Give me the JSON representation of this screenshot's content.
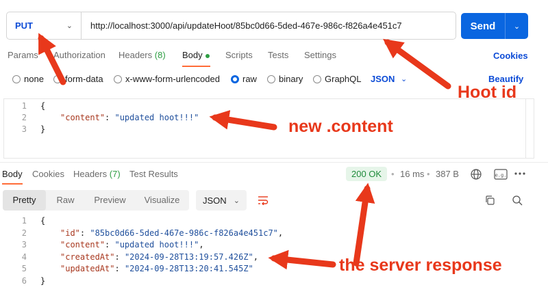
{
  "request": {
    "method": "PUT",
    "url": "http://localhost:3000/api/updateHoot/85bc0d66-5ded-467e-986c-f826a4e451c7",
    "send_label": "Send"
  },
  "req_tabs": [
    {
      "label": "Params"
    },
    {
      "label": "Authorization"
    },
    {
      "label": "Headers",
      "count": "(8)"
    },
    {
      "label": "Body"
    },
    {
      "label": "Scripts"
    },
    {
      "label": "Tests"
    },
    {
      "label": "Settings"
    }
  ],
  "cookies_label": "Cookies",
  "body_types": [
    "none",
    "form-data",
    "x-www-form-urlencoded",
    "raw",
    "binary",
    "GraphQL"
  ],
  "selected_body_type": "raw",
  "language": "JSON",
  "beautify_label": "Beautify",
  "request_body": {
    "line_numbers": [
      "1",
      "2",
      "3"
    ],
    "open": "{",
    "key": "\"content\"",
    "value": "\"updated hoot!!!\"",
    "close": "}"
  },
  "response_tabs": [
    {
      "label": "Body"
    },
    {
      "label": "Cookies"
    },
    {
      "label": "Headers",
      "count": "(7)"
    },
    {
      "label": "Test Results"
    }
  ],
  "status": {
    "code": "200 OK",
    "time": "16 ms",
    "size": "387 B"
  },
  "view_modes": [
    "Pretty",
    "Raw",
    "Preview",
    "Visualize"
  ],
  "response_format": "JSON",
  "response_body": {
    "line_numbers": [
      "1",
      "2",
      "3",
      "4",
      "5",
      "6"
    ],
    "open": "{",
    "fields": [
      {
        "key": "\"id\"",
        "value": "\"85bc0d66-5ded-467e-986c-f826a4e451c7\"",
        "comma": ","
      },
      {
        "key": "\"content\"",
        "value": "\"updated hoot!!!\"",
        "comma": ","
      },
      {
        "key": "\"createdAt\"",
        "value": "\"2024-09-28T13:19:57.426Z\"",
        "comma": ","
      },
      {
        "key": "\"updatedAt\"",
        "value": "\"2024-09-28T13:20:41.545Z\"",
        "comma": ""
      }
    ],
    "close": "}"
  },
  "annotations": {
    "hoot_id": "Hoot id",
    "new_content": "new .content",
    "server_response": "the server response"
  },
  "colors": {
    "accent": "#0a66e0",
    "active_tab_underline": "#ff6c37",
    "annotation": "#e8381b",
    "status_ok": "#1e8a3a"
  },
  "icons": [
    "chevron-down-icon",
    "wrap-lines-icon",
    "globe-icon",
    "save-example-icon",
    "more-icon",
    "copy-icon",
    "search-icon"
  ]
}
